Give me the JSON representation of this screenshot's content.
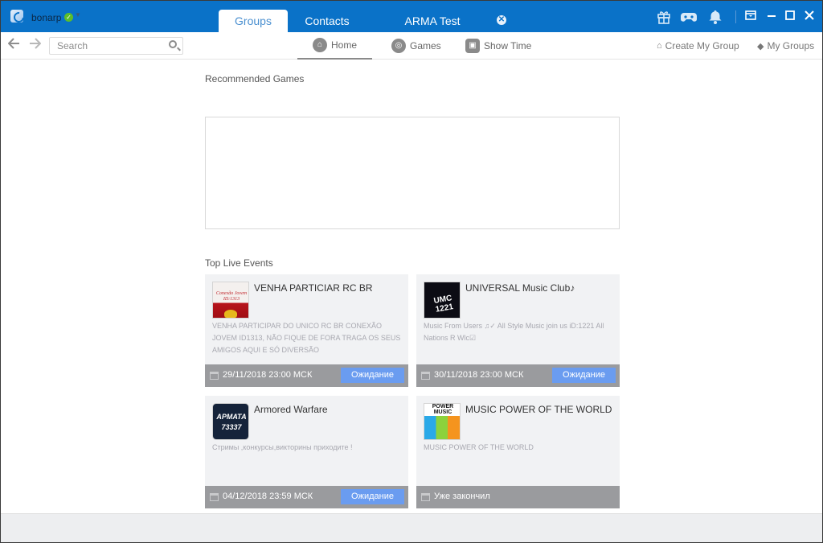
{
  "titlebar": {
    "username": "bonarp",
    "status": "online",
    "status_color": "#5bbd2b",
    "tabs": [
      {
        "label": "Groups",
        "active": true
      },
      {
        "label": "Contacts",
        "active": false
      },
      {
        "label": "ARMA Test",
        "active": false
      }
    ],
    "tab_close_glyph": "✕",
    "icons": [
      "gift-icon",
      "gamepad-icon",
      "bell-icon"
    ],
    "window_buttons": [
      "dropdown-window-icon",
      "minimize-icon",
      "maximize-icon",
      "close-icon"
    ],
    "accent": "#0a72c8"
  },
  "navbar": {
    "search_placeholder": "Search",
    "subtabs": [
      {
        "label": "Home",
        "icon": "home-icon",
        "active": true
      },
      {
        "label": "Games",
        "icon": "gamepad-icon",
        "active": false
      },
      {
        "label": "Show Time",
        "icon": "film-icon",
        "active": false
      }
    ],
    "links": [
      {
        "label": "Create My Group",
        "icon": "home-plus-icon"
      },
      {
        "label": "My Groups",
        "icon": "tag-icon"
      }
    ]
  },
  "main": {
    "recommended_title": "Recommended Games",
    "live_title": "Top Live Events",
    "events": [
      {
        "title": "VENHA PARTICIAR RC BR",
        "description": "VENHA PARTICIPAR DO UNICO RC BR CONEXÃO JOVEM ID1313, NÃO FIQUE DE FORA TRAGA OS SEUS AMIGOS AQUI E SÓ DIVERSÃO",
        "date": "29/11/2018 23:00 МСК",
        "status": "Ожидание",
        "thumb_text": "Conexão Jovem ID:1313"
      },
      {
        "title": "UNIVERSAL Music Club♪",
        "description": "Music From Users ♫✓ All Style Music join us iD:1221 All Nations R Wlc☑",
        "date": "30/11/2018 23:00 МСК",
        "status": "Ожидание",
        "thumb_text": "UMC 1221"
      },
      {
        "title": "Armored Warfare",
        "description": "Стримы ,конкурсы,викторины приходите !",
        "date": "04/12/2018 23:59 МСК",
        "status": "Ожидание",
        "thumb_text": "АРМАТА 73337"
      },
      {
        "title": "MUSIC POWER OF THE WORLD",
        "description": "MUSIC POWER OF THE WORLD",
        "date": "Уже закончил",
        "status": null,
        "thumb_text": "POWER MUSIC"
      }
    ],
    "status_button_color": "#6a9cf0"
  }
}
